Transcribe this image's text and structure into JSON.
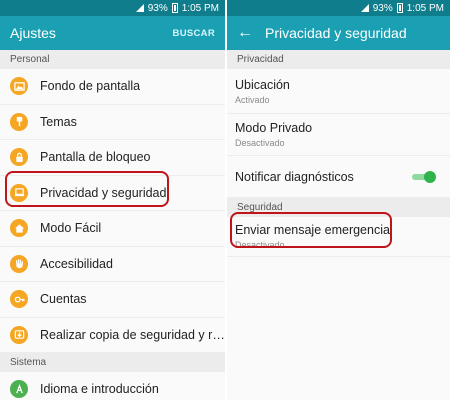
{
  "status": {
    "battery": "93%",
    "time": "1:05 PM"
  },
  "left": {
    "title": "Ajustes",
    "action": "BUSCAR",
    "section_personal": "Personal",
    "personal_items": [
      {
        "label": "Fondo de pantalla",
        "icon": "wallpaper-icon"
      },
      {
        "label": "Temas",
        "icon": "brush-icon"
      },
      {
        "label": "Pantalla de bloqueo",
        "icon": "lock-icon"
      },
      {
        "label": "Privacidad y seguridad",
        "icon": "privacy-icon"
      },
      {
        "label": "Modo Fácil",
        "icon": "home-icon"
      },
      {
        "label": "Accesibilidad",
        "icon": "hand-icon"
      },
      {
        "label": "Cuentas",
        "icon": "key-icon"
      },
      {
        "label": "Realizar copia de seguridad y res...",
        "icon": "backup-icon"
      }
    ],
    "section_sistema": "Sistema",
    "sistema_items": [
      {
        "label": "Idioma e introducción",
        "icon": "language-icon"
      }
    ]
  },
  "right": {
    "title": "Privacidad y seguridad",
    "section_privacidad": "Privacidad",
    "ubicacion": {
      "title": "Ubicación",
      "subtitle": "Activado"
    },
    "modo_privado": {
      "title": "Modo Privado",
      "subtitle": "Desactivado"
    },
    "notificar": {
      "title": "Notificar diagnósticos",
      "state": "on"
    },
    "section_seguridad": "Seguridad",
    "emergencia": {
      "title": "Enviar mensaje emergencia",
      "subtitle": "Desactivado"
    }
  },
  "colors": {
    "statusbar": "#0f7d8c",
    "appbar": "#1aa0b2",
    "icon": "#f5a623",
    "highlight": "#c0141d",
    "toggle": "#2fb34a"
  }
}
